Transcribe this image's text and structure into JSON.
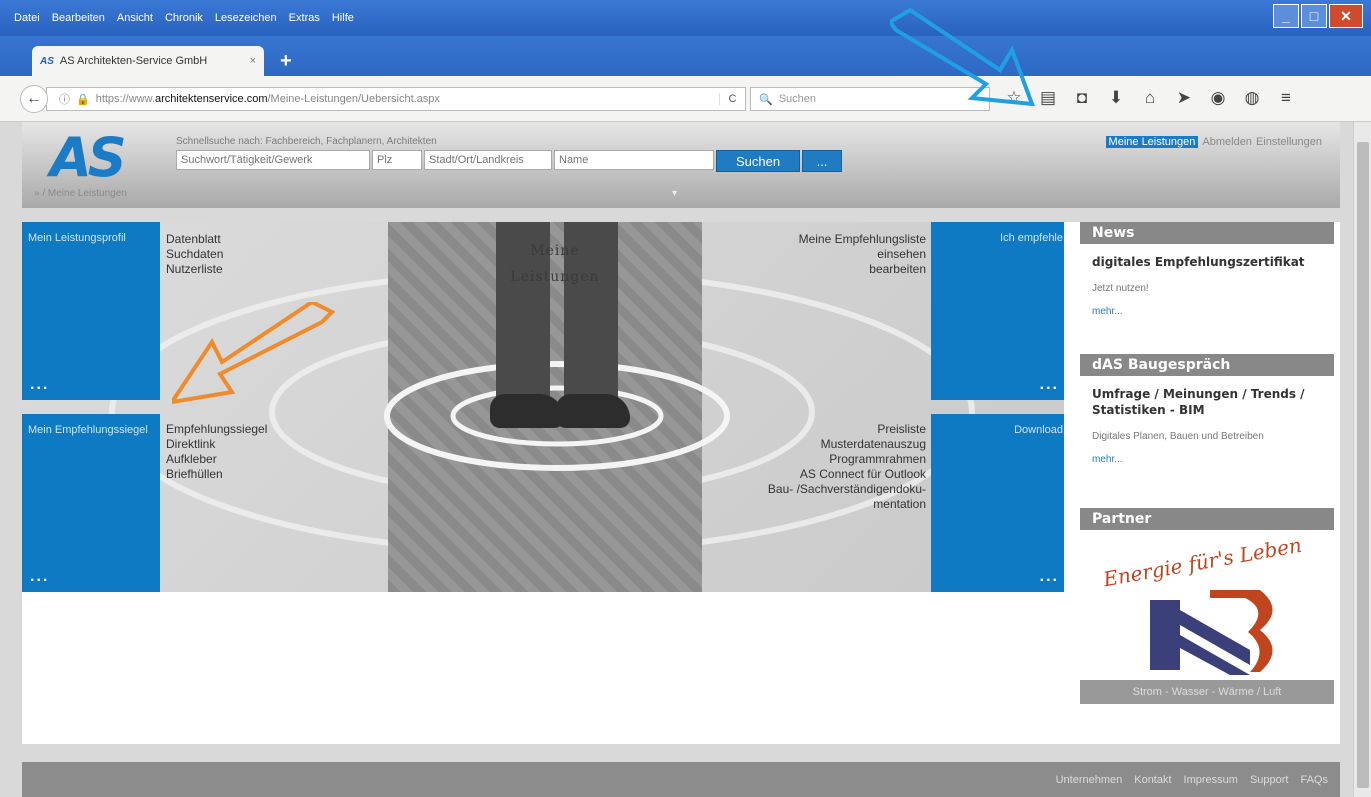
{
  "window": {
    "menu": [
      "Datei",
      "Bearbeiten",
      "Ansicht",
      "Chronik",
      "Lesezeichen",
      "Extras",
      "Hilfe"
    ]
  },
  "tab": {
    "favicon": "AS",
    "title": "AS Architekten-Service GmbH",
    "close": "×",
    "new_tab": "+"
  },
  "nav": {
    "url_prefix": "https://www.",
    "url_domain": "architektenservice.com",
    "url_path": "/Meine-Leistungen/Uebersicht.aspx",
    "reload": "C",
    "search_placeholder": "Suchen"
  },
  "toolbar_icons": [
    "star-icon",
    "reading-list-icon",
    "pocket-icon",
    "download-icon",
    "home-icon",
    "send-icon",
    "sync-icon",
    "chat-icon",
    "menu-icon"
  ],
  "site": {
    "logo": "AS",
    "search_hint": "Schnellsuche nach: Fachbereich, Fachplanern, Architekten",
    "fields": {
      "keyword": "Suchwort/Tätigkeit/Gewerk",
      "zip": "Plz",
      "city": "Stadt/Ort/Landkreis",
      "name": "Name"
    },
    "search_button": "Suchen",
    "more_button": "...",
    "breadcrumb": "» / Meine Leistungen",
    "head_nav": [
      "Meine Leistungen",
      "Abmelden",
      "Einstellungen"
    ]
  },
  "stage": {
    "title_line1": "Meine",
    "title_line2": "Leistungen"
  },
  "tiles": {
    "profile": {
      "title": "Mein Leistungsprofil",
      "links": [
        "Datenblatt",
        "Suchdaten",
        "Nutzerliste"
      ]
    },
    "recommend": {
      "title": "Ich empfehle",
      "links": [
        "Meine Empfehlungsliste",
        "einsehen",
        "bearbeiten"
      ]
    },
    "seal": {
      "title": "Mein Empfehlungssiegel",
      "links": [
        "Empfehlungssiegel",
        "Direktlink",
        "Aufkleber",
        "Briefhüllen"
      ]
    },
    "download": {
      "title": "Download",
      "links": [
        "Preisliste",
        "Musterdatenauszug",
        "Programmrahmen",
        "AS Connect für Outlook",
        "Bau- /Sachverständigendoku-",
        "mentation"
      ]
    },
    "dots": "..."
  },
  "sidebar": {
    "news": {
      "head": "News",
      "title": "digitales Empfehlungszertifikat",
      "text": "Jetzt nutzen!",
      "more": "mehr..."
    },
    "baugespraech": {
      "head": "dAS Baugespräch",
      "title": "Umfrage / Meinungen / Trends / Statistiken - BIM",
      "text": "Digitales Planen, Bauen und Betreiben",
      "more": "mehr..."
    },
    "partner": {
      "head": "Partner",
      "slogan": "Energie für's Leben",
      "caption": "Strom - Wasser - Wärme / Luft"
    }
  },
  "footer": [
    "Unternehmen",
    "Kontakt",
    "Impressum",
    "Support",
    "FAQs"
  ]
}
